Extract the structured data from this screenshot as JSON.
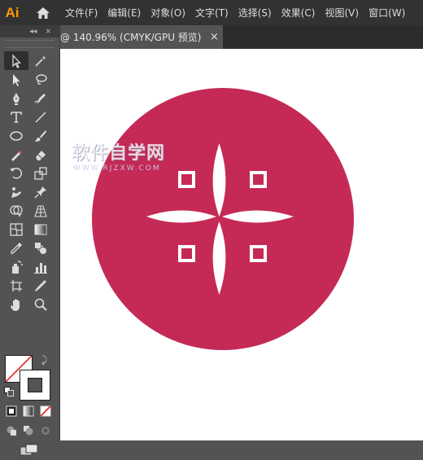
{
  "app": {
    "logo": "Ai",
    "icon": "home-icon"
  },
  "menu": {
    "items": [
      "文件(F)",
      "编辑(E)",
      "对象(O)",
      "文字(T)",
      "选择(S)",
      "效果(C)",
      "视图(V)",
      "窗口(W)"
    ]
  },
  "document_tab": {
    "title": "@ 140.96% (CMYK/GPU 预览)",
    "close": "×"
  },
  "toolpanel": {
    "collapse": "◂◂",
    "close": "×",
    "tools": [
      "selection-tool-icon",
      "magic-wand-icon",
      "direct-selection-icon",
      "lasso-icon",
      "pen-icon",
      "curvature-icon",
      "type-icon",
      "line-segment-icon",
      "ellipse-icon",
      "paintbrush-icon",
      "shaper-icon",
      "eraser-icon",
      "rotate-icon",
      "scale-icon",
      "puppet-warp-icon",
      "pin-icon",
      "shape-builder-icon",
      "perspective-grid-icon",
      "mesh-icon",
      "gradient-icon",
      "eyedropper-icon",
      "blend-icon",
      "symbol-sprayer-icon",
      "column-graph-icon",
      "artboard-icon",
      "slice-icon",
      "hand-icon",
      "zoom-icon"
    ]
  },
  "colors": {
    "circle": "#c42a55",
    "artwork_white": "#ffffff",
    "fill": "none",
    "stroke": "#535353"
  },
  "watermark": {
    "main": "软件自学网",
    "sub": "WWW.RJZXW.COM"
  }
}
